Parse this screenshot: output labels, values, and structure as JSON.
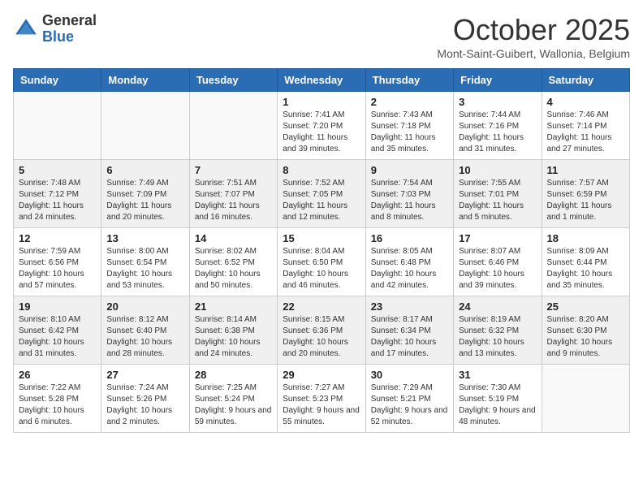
{
  "header": {
    "logo_general": "General",
    "logo_blue": "Blue",
    "month_title": "October 2025",
    "location": "Mont-Saint-Guibert, Wallonia, Belgium"
  },
  "days_of_week": [
    "Sunday",
    "Monday",
    "Tuesday",
    "Wednesday",
    "Thursday",
    "Friday",
    "Saturday"
  ],
  "weeks": [
    {
      "shade": false,
      "days": [
        {
          "num": "",
          "info": ""
        },
        {
          "num": "",
          "info": ""
        },
        {
          "num": "",
          "info": ""
        },
        {
          "num": "1",
          "info": "Sunrise: 7:41 AM\nSunset: 7:20 PM\nDaylight: 11 hours\nand 39 minutes."
        },
        {
          "num": "2",
          "info": "Sunrise: 7:43 AM\nSunset: 7:18 PM\nDaylight: 11 hours\nand 35 minutes."
        },
        {
          "num": "3",
          "info": "Sunrise: 7:44 AM\nSunset: 7:16 PM\nDaylight: 11 hours\nand 31 minutes."
        },
        {
          "num": "4",
          "info": "Sunrise: 7:46 AM\nSunset: 7:14 PM\nDaylight: 11 hours\nand 27 minutes."
        }
      ]
    },
    {
      "shade": true,
      "days": [
        {
          "num": "5",
          "info": "Sunrise: 7:48 AM\nSunset: 7:12 PM\nDaylight: 11 hours\nand 24 minutes."
        },
        {
          "num": "6",
          "info": "Sunrise: 7:49 AM\nSunset: 7:09 PM\nDaylight: 11 hours\nand 20 minutes."
        },
        {
          "num": "7",
          "info": "Sunrise: 7:51 AM\nSunset: 7:07 PM\nDaylight: 11 hours\nand 16 minutes."
        },
        {
          "num": "8",
          "info": "Sunrise: 7:52 AM\nSunset: 7:05 PM\nDaylight: 11 hours\nand 12 minutes."
        },
        {
          "num": "9",
          "info": "Sunrise: 7:54 AM\nSunset: 7:03 PM\nDaylight: 11 hours\nand 8 minutes."
        },
        {
          "num": "10",
          "info": "Sunrise: 7:55 AM\nSunset: 7:01 PM\nDaylight: 11 hours\nand 5 minutes."
        },
        {
          "num": "11",
          "info": "Sunrise: 7:57 AM\nSunset: 6:59 PM\nDaylight: 11 hours\nand 1 minute."
        }
      ]
    },
    {
      "shade": false,
      "days": [
        {
          "num": "12",
          "info": "Sunrise: 7:59 AM\nSunset: 6:56 PM\nDaylight: 10 hours\nand 57 minutes."
        },
        {
          "num": "13",
          "info": "Sunrise: 8:00 AM\nSunset: 6:54 PM\nDaylight: 10 hours\nand 53 minutes."
        },
        {
          "num": "14",
          "info": "Sunrise: 8:02 AM\nSunset: 6:52 PM\nDaylight: 10 hours\nand 50 minutes."
        },
        {
          "num": "15",
          "info": "Sunrise: 8:04 AM\nSunset: 6:50 PM\nDaylight: 10 hours\nand 46 minutes."
        },
        {
          "num": "16",
          "info": "Sunrise: 8:05 AM\nSunset: 6:48 PM\nDaylight: 10 hours\nand 42 minutes."
        },
        {
          "num": "17",
          "info": "Sunrise: 8:07 AM\nSunset: 6:46 PM\nDaylight: 10 hours\nand 39 minutes."
        },
        {
          "num": "18",
          "info": "Sunrise: 8:09 AM\nSunset: 6:44 PM\nDaylight: 10 hours\nand 35 minutes."
        }
      ]
    },
    {
      "shade": true,
      "days": [
        {
          "num": "19",
          "info": "Sunrise: 8:10 AM\nSunset: 6:42 PM\nDaylight: 10 hours\nand 31 minutes."
        },
        {
          "num": "20",
          "info": "Sunrise: 8:12 AM\nSunset: 6:40 PM\nDaylight: 10 hours\nand 28 minutes."
        },
        {
          "num": "21",
          "info": "Sunrise: 8:14 AM\nSunset: 6:38 PM\nDaylight: 10 hours\nand 24 minutes."
        },
        {
          "num": "22",
          "info": "Sunrise: 8:15 AM\nSunset: 6:36 PM\nDaylight: 10 hours\nand 20 minutes."
        },
        {
          "num": "23",
          "info": "Sunrise: 8:17 AM\nSunset: 6:34 PM\nDaylight: 10 hours\nand 17 minutes."
        },
        {
          "num": "24",
          "info": "Sunrise: 8:19 AM\nSunset: 6:32 PM\nDaylight: 10 hours\nand 13 minutes."
        },
        {
          "num": "25",
          "info": "Sunrise: 8:20 AM\nSunset: 6:30 PM\nDaylight: 10 hours\nand 9 minutes."
        }
      ]
    },
    {
      "shade": false,
      "days": [
        {
          "num": "26",
          "info": "Sunrise: 7:22 AM\nSunset: 5:28 PM\nDaylight: 10 hours\nand 6 minutes."
        },
        {
          "num": "27",
          "info": "Sunrise: 7:24 AM\nSunset: 5:26 PM\nDaylight: 10 hours\nand 2 minutes."
        },
        {
          "num": "28",
          "info": "Sunrise: 7:25 AM\nSunset: 5:24 PM\nDaylight: 9 hours\nand 59 minutes."
        },
        {
          "num": "29",
          "info": "Sunrise: 7:27 AM\nSunset: 5:23 PM\nDaylight: 9 hours\nand 55 minutes."
        },
        {
          "num": "30",
          "info": "Sunrise: 7:29 AM\nSunset: 5:21 PM\nDaylight: 9 hours\nand 52 minutes."
        },
        {
          "num": "31",
          "info": "Sunrise: 7:30 AM\nSunset: 5:19 PM\nDaylight: 9 hours\nand 48 minutes."
        },
        {
          "num": "",
          "info": ""
        }
      ]
    }
  ]
}
